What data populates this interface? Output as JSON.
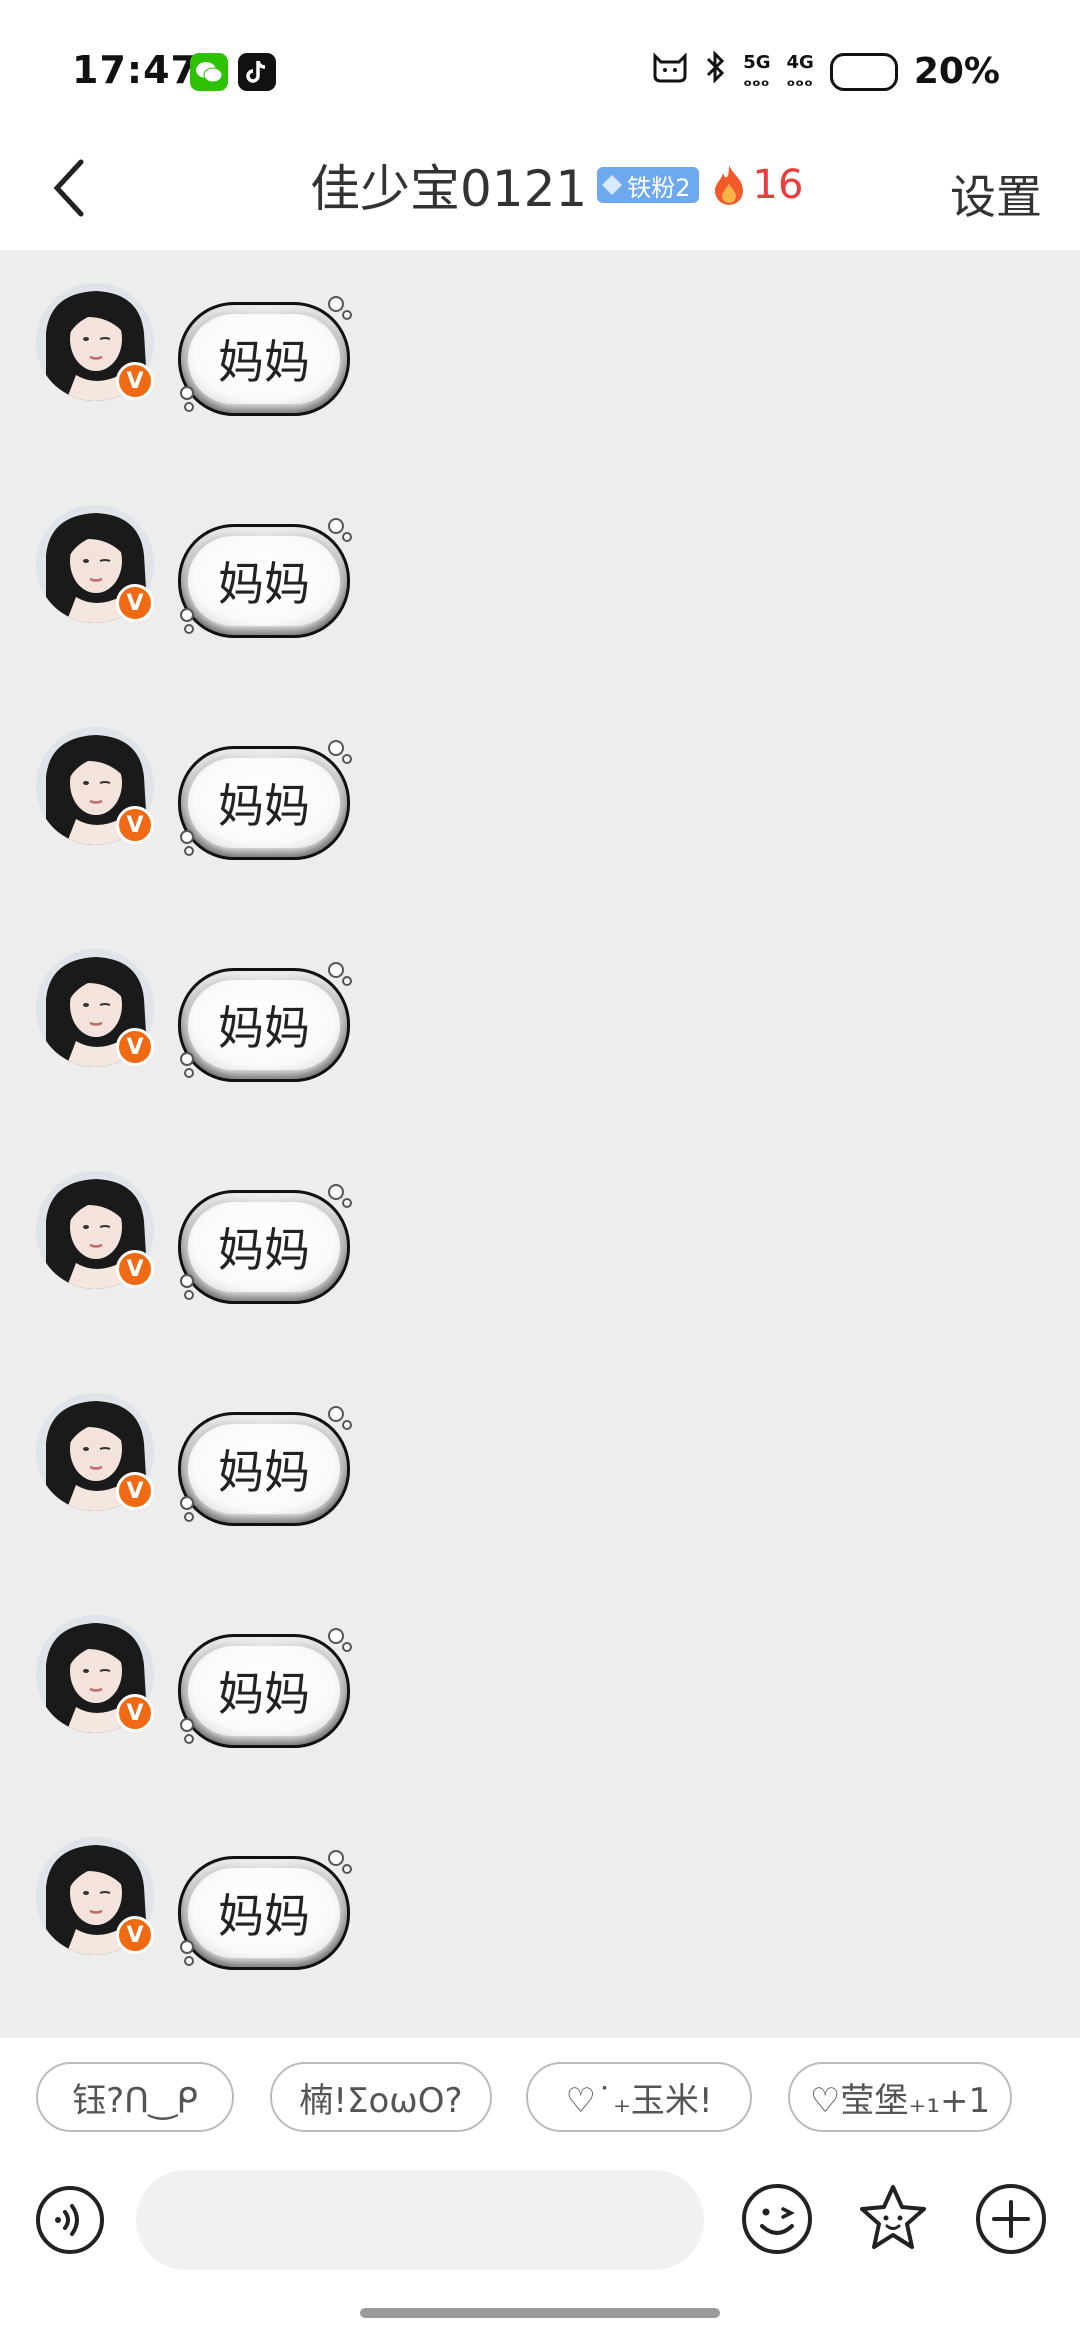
{
  "status_bar": {
    "time": "17:47",
    "battery": "20%",
    "network_1": "5G",
    "network_2": "4G",
    "bluetooth_icon": "bluetooth-icon",
    "notification_icon": "cat-icon"
  },
  "header": {
    "title": "佳少宝0121",
    "fan_badge": "铁粉2",
    "streak_count": "16",
    "settings_label": "设置"
  },
  "messages": [
    {
      "text": "妈妈"
    },
    {
      "text": "妈妈"
    },
    {
      "text": "妈妈"
    },
    {
      "text": "妈妈"
    },
    {
      "text": "妈妈"
    },
    {
      "text": "妈妈"
    },
    {
      "text": "妈妈"
    },
    {
      "text": "妈妈"
    }
  ],
  "avatar_badge": "V",
  "quick_replies": [
    "钰?ᑎ‿ᑭ",
    "楠!ΣoωO?",
    "♡˙₊玉米!",
    "♡莹堡₊₁+1"
  ],
  "input": {
    "placeholder": ""
  },
  "colors": {
    "chat_background": "#ededed",
    "streak_red": "#ef3b3b",
    "verified_orange": "#f06a13",
    "fan_badge_blue": "#6ea8ef"
  }
}
